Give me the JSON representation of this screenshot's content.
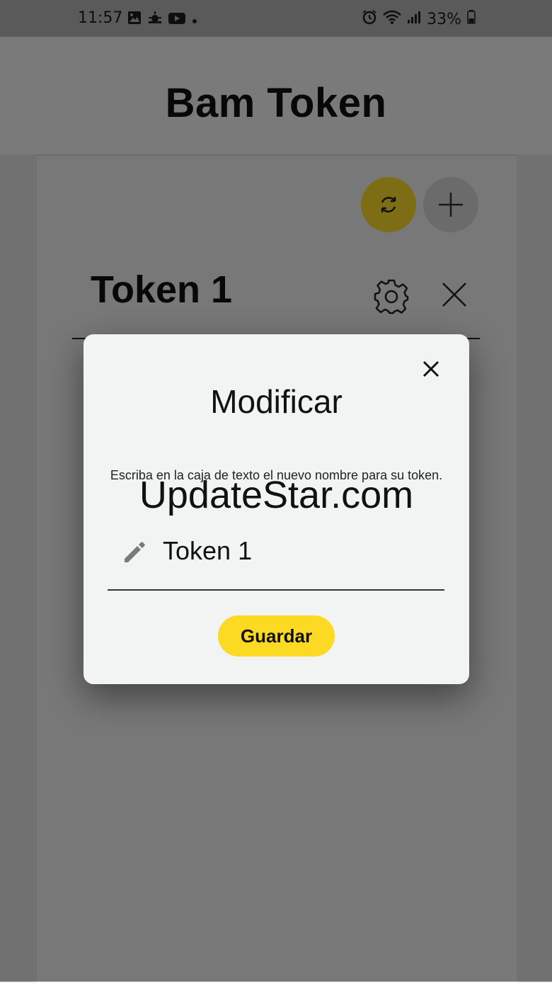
{
  "status_bar": {
    "time": "11:57",
    "battery": "33%",
    "icons": [
      "image-icon",
      "weather-icon",
      "youtube-icon",
      "dot-icon",
      "alarm-icon",
      "wifi-icon",
      "signal-icon",
      "battery-icon"
    ]
  },
  "app": {
    "title": "Bam Token"
  },
  "actions": {
    "refresh_icon": "refresh-icon",
    "add_icon": "plus-icon"
  },
  "token": {
    "name": "Token 1",
    "settings_icon": "gear-icon",
    "delete_icon": "close-icon"
  },
  "dialog": {
    "title": "Modificar",
    "message": "Escriba en la caja de texto el nuevo nombre para su token.",
    "input_value": "Token 1",
    "input_icon": "pencil-icon",
    "save_label": "Guardar",
    "close_icon": "close-icon"
  },
  "watermark": "UpdateStar.com",
  "colors": {
    "accent": "#fcd922",
    "refresh_button": "#fbdc2c",
    "add_button": "#d6d6d8",
    "dialog_bg": "#f2f3f3"
  }
}
